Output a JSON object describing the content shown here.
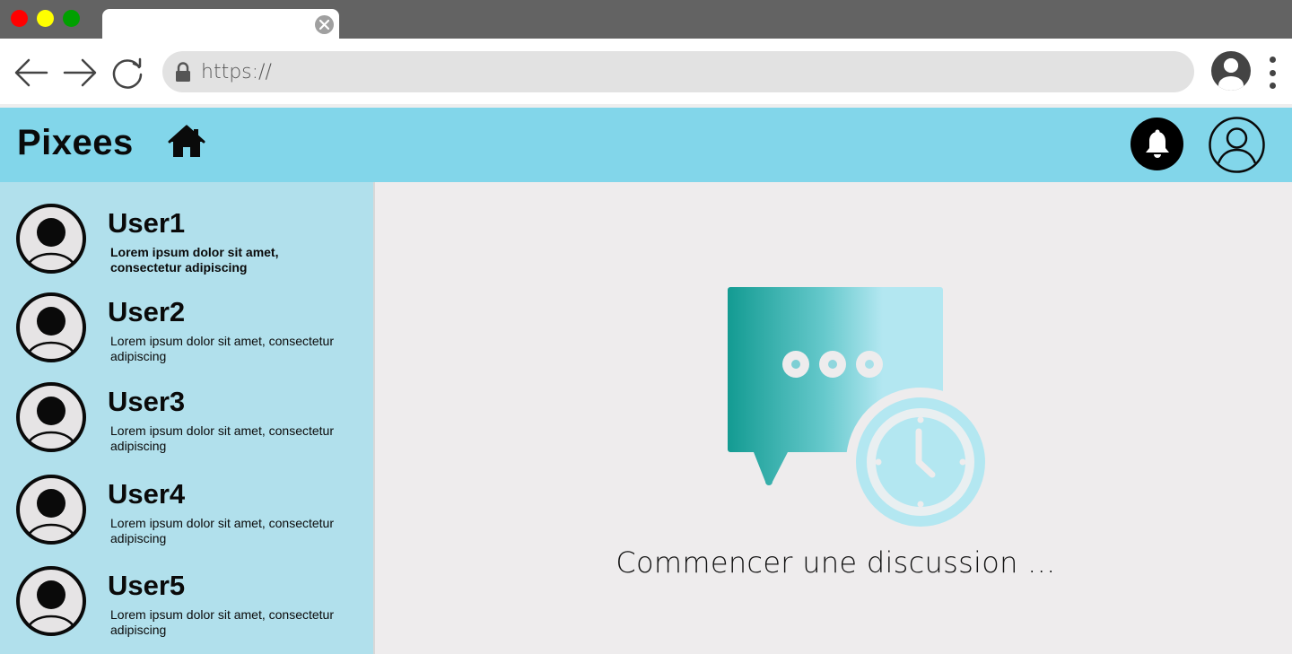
{
  "browser": {
    "window_controls": [
      {
        "name": "close",
        "color": "#ff0000"
      },
      {
        "name": "minimize",
        "color": "#ffff00"
      },
      {
        "name": "maximize",
        "color": "#00a000"
      }
    ],
    "tab": {
      "title": "",
      "close_icon": "close-circle-icon"
    },
    "nav_icons": [
      "back-arrow-icon",
      "forward-arrow-icon",
      "reload-icon"
    ],
    "address_bar": {
      "value": "https://",
      "icon": "lock-icon"
    },
    "profile_icon": "account-icon",
    "menu_icon": "kebab-menu-icon"
  },
  "header": {
    "brand": "Pixees",
    "home_icon": "home-icon",
    "notification_icon": "bell-icon",
    "profile_icon": "user-circle-icon",
    "background": "#82d6ea"
  },
  "sidebar": {
    "background": "#b1e0ec",
    "conversations": [
      {
        "name": "User1",
        "preview": "Lorem ipsum dolor sit amet, consectetur adipiscing",
        "unread": true
      },
      {
        "name": "User2",
        "preview": "Lorem ipsum dolor sit amet, consectetur adipiscing",
        "unread": false
      },
      {
        "name": "User3",
        "preview": "Lorem ipsum dolor sit amet, consectetur adipiscing",
        "unread": false
      },
      {
        "name": "User4",
        "preview": "Lorem ipsum dolor sit amet, consectetur adipiscing",
        "unread": false
      },
      {
        "name": "User5",
        "preview": "Lorem ipsum dolor sit amet, consectetur adipiscing",
        "unread": false
      }
    ]
  },
  "main": {
    "illustration": "chat-bubble-clock-icon",
    "empty_state_text": "Commencer une discussion ..."
  }
}
